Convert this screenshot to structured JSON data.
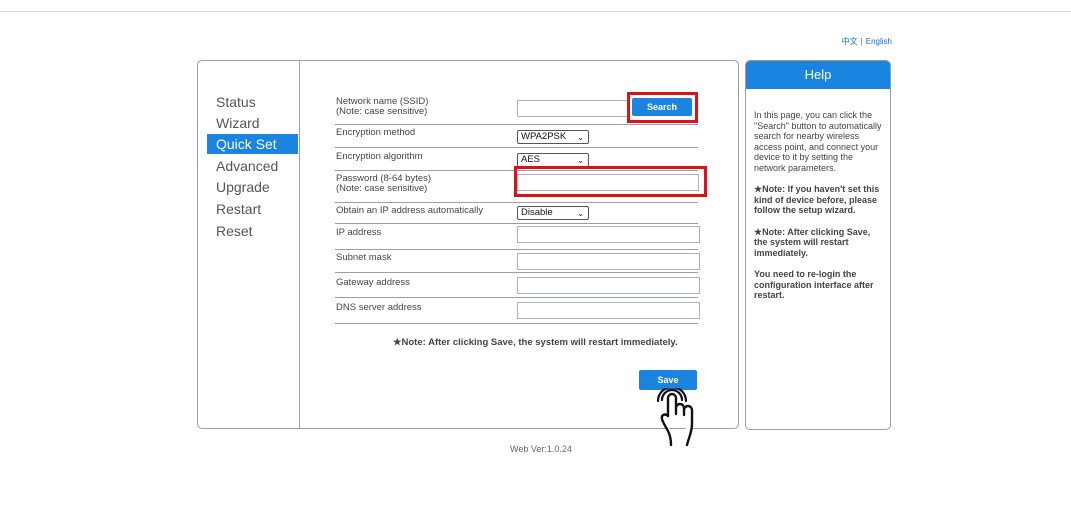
{
  "language": {
    "chinese": "中文",
    "separator": "|",
    "english": "English"
  },
  "sidebar": {
    "items": [
      {
        "label": "Status"
      },
      {
        "label": "Wizard"
      },
      {
        "label": "Quick Set"
      },
      {
        "label": "Advanced"
      },
      {
        "label": "Upgrade"
      },
      {
        "label": "Restart"
      },
      {
        "label": "Reset"
      }
    ],
    "active": "Quick Set"
  },
  "form": {
    "ssid": {
      "label": "Network name (SSID)",
      "sub": "(Note: case sensitive)",
      "value": ""
    },
    "search_button": "Search",
    "encryption_method": {
      "label": "Encryption method",
      "selected": "WPA2PSK"
    },
    "encryption_algorithm": {
      "label": "Encryption algorithm",
      "selected": "AES"
    },
    "password": {
      "label": "Password (8-64 bytes)",
      "sub": "(Note: case sensitive)",
      "value": ""
    },
    "obtain_ip": {
      "label": "Obtain an IP address automatically",
      "selected": "Disable"
    },
    "ip_address": {
      "label": "IP address",
      "value": ""
    },
    "subnet_mask": {
      "label": "Subnet mask",
      "value": ""
    },
    "gateway": {
      "label": "Gateway address",
      "value": ""
    },
    "dns": {
      "label": "DNS server address",
      "value": ""
    },
    "note": "★Note: After clicking Save, the system will restart immediately.",
    "save_button": "Save"
  },
  "help": {
    "title": "Help",
    "paragraphs": [
      "In this page, you can click the \"Search\" button to automatically search for nearby wireless access point, and connect your device to it by setting the network parameters.",
      "★Note: If you haven't set this kind of device before, please follow the setup wizard.",
      "★Note: After clicking Save, the system will restart immediately.",
      "You need to re-login the configuration interface after restart."
    ]
  },
  "footer": {
    "version": "Web Ver:1.0.24"
  },
  "colors": {
    "accent": "#1a84e0",
    "highlight": "#e0101a"
  }
}
